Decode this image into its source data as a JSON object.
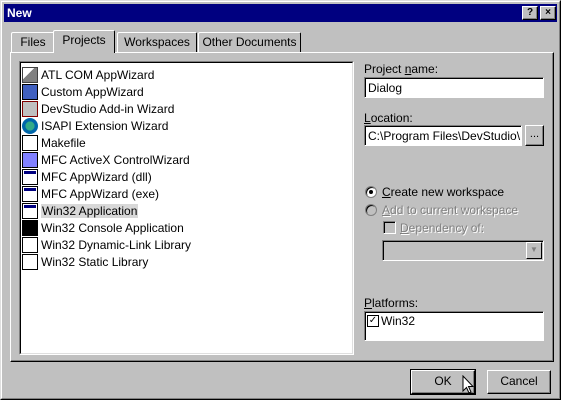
{
  "window": {
    "title": "New",
    "help_label": "?",
    "close_label": "×"
  },
  "tabs": [
    {
      "label": "Files"
    },
    {
      "label": "Projects"
    },
    {
      "label": "Workspaces"
    },
    {
      "label": "Other Documents"
    }
  ],
  "project_types": [
    {
      "label": "ATL COM AppWizard",
      "icon": "atl-wizard-icon"
    },
    {
      "label": "Custom AppWizard",
      "icon": "custom-wizard-icon"
    },
    {
      "label": "DevStudio Add-in Wizard",
      "icon": "addin-wizard-icon"
    },
    {
      "label": "ISAPI Extension Wizard",
      "icon": "globe-icon"
    },
    {
      "label": "Makefile",
      "icon": "makefile-icon"
    },
    {
      "label": "MFC ActiveX ControlWizard",
      "icon": "activex-icon"
    },
    {
      "label": "MFC AppWizard (dll)",
      "icon": "mfc-dll-icon"
    },
    {
      "label": "MFC AppWizard (exe)",
      "icon": "mfc-exe-icon"
    },
    {
      "label": "Win32 Application",
      "icon": "win32-app-icon",
      "selected": true
    },
    {
      "label": "Win32 Console Application",
      "icon": "console-icon"
    },
    {
      "label": "Win32 Dynamic-Link Library",
      "icon": "dll-icon"
    },
    {
      "label": "Win32 Static Library",
      "icon": "lib-icon"
    }
  ],
  "project_name": {
    "label_pre": "Project ",
    "label_u": "n",
    "label_post": "ame:",
    "value": "Dialog"
  },
  "location": {
    "label_u": "L",
    "label_post": "ocation:",
    "value": "C:\\Program Files\\DevStudio\\My",
    "browse_label": "..."
  },
  "workspace": {
    "create_u": "C",
    "create_post": "reate new workspace",
    "add_u": "A",
    "add_post": "dd to current workspace",
    "dependency_u": "D",
    "dependency_post": "ependency of:"
  },
  "platforms": {
    "label_u": "P",
    "label_post": "latforms:",
    "items": [
      {
        "label": "Win32",
        "checked": true
      }
    ]
  },
  "buttons": {
    "ok": "OK",
    "cancel": "Cancel"
  }
}
